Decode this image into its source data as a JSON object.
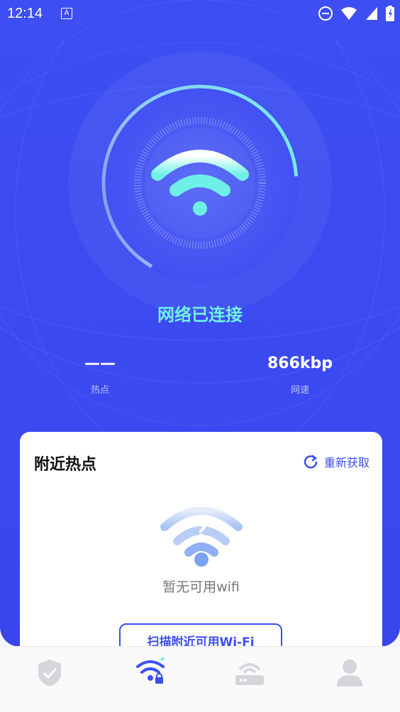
{
  "status_bar": {
    "time": "12:14",
    "notification_icon_letter": "A"
  },
  "hero": {
    "connection_status": "网络已连接",
    "stats": [
      {
        "value": "——",
        "label": "热点"
      },
      {
        "value": "866kbp",
        "label": "网速"
      }
    ]
  },
  "card": {
    "title": "附近热点",
    "refresh_label": "重新获取",
    "empty_text": "暂无可用wifi",
    "scan_button_label": "扫描附近可用Wi-Fi"
  },
  "bottom_nav": {
    "items": [
      {
        "icon": "shield-check-icon",
        "active": false
      },
      {
        "icon": "wifi-lock-icon",
        "active": true
      },
      {
        "icon": "router-icon",
        "active": false
      },
      {
        "icon": "user-icon",
        "active": false
      }
    ]
  },
  "colors": {
    "primary": "#3d4ef2",
    "accent": "#6ff0e6",
    "white": "#ffffff"
  }
}
